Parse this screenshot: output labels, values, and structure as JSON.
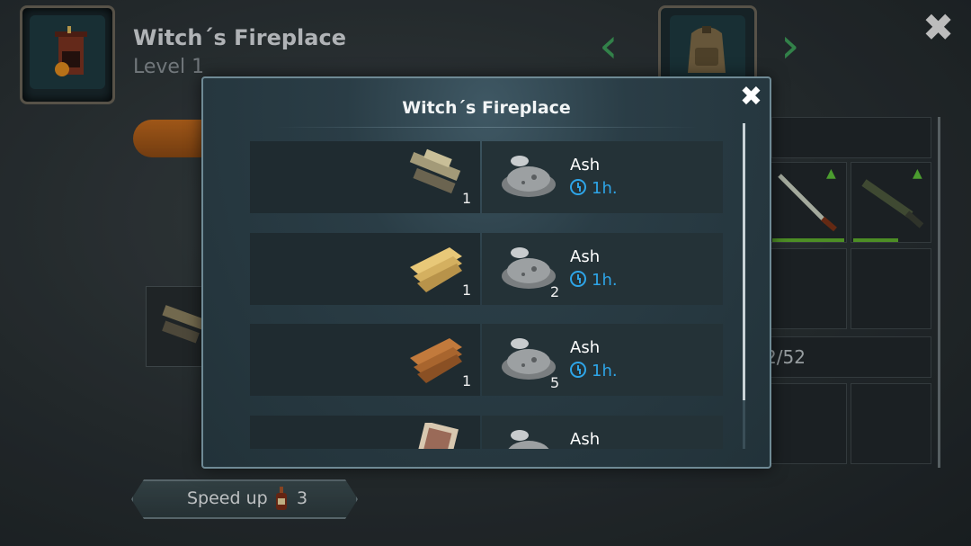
{
  "background": {
    "building_title": "Witch´s Fireplace",
    "building_level": "Level 1",
    "capacity_text": "2/52",
    "speed_up": {
      "label": "Speed up",
      "count": "3",
      "icon": "bottle-icon"
    }
  },
  "modal": {
    "title": "Witch´s Fireplace",
    "close_icon": "close-icon",
    "recipes": [
      {
        "input_icon": "logs-icon",
        "input_qty": "1",
        "output_icon": "ash-icon",
        "output_qty": "",
        "output_name": "Ash",
        "time": "1h."
      },
      {
        "input_icon": "planks-light-icon",
        "input_qty": "1",
        "output_icon": "ash-icon",
        "output_qty": "2",
        "output_name": "Ash",
        "time": "1h."
      },
      {
        "input_icon": "planks-dark-icon",
        "input_qty": "1",
        "output_icon": "ash-icon",
        "output_qty": "5",
        "output_name": "Ash",
        "time": "1h."
      },
      {
        "input_icon": "magazine-icon",
        "input_qty": "",
        "output_icon": "ash-icon",
        "output_qty": "",
        "output_name": "Ash",
        "time": ""
      }
    ]
  },
  "colors": {
    "accent_time": "#2ea5e8",
    "upgrade_green": "#5cbf3a",
    "modal_border": "#6f8a95"
  }
}
